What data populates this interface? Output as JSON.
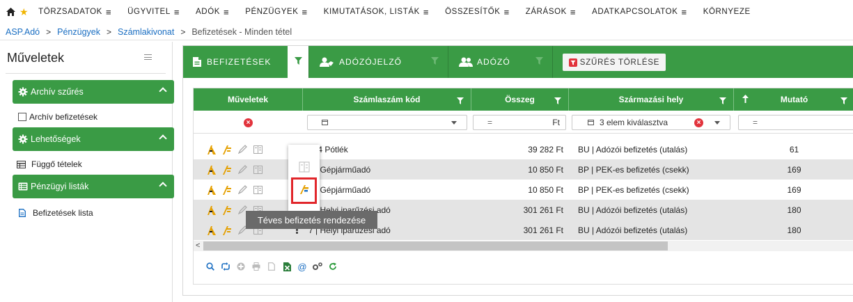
{
  "topmenu": {
    "items": [
      {
        "label": "TÖRZSADATOK"
      },
      {
        "label": "ÜGYVITEL"
      },
      {
        "label": "ADÓK"
      },
      {
        "label": "PÉNZÜGYEK"
      },
      {
        "label": "KIMUTATÁSOK, LISTÁK"
      },
      {
        "label": "ÖSSZESÍTŐK"
      },
      {
        "label": "ZÁRÁSOK"
      },
      {
        "label": "ADATKAPCSOLATOK"
      },
      {
        "label": "KÖRNYEZE"
      }
    ],
    "menu_glyph": "≡"
  },
  "breadcrumb": {
    "items": [
      "ASP.Adó",
      "Pénzügyek",
      "Számlakivonat"
    ],
    "current": "Befizetések - Minden tétel",
    "separator": ">"
  },
  "sidebar": {
    "title": "Műveletek",
    "groups": [
      {
        "label": "Archív szűrés",
        "icon": "gear-icon"
      },
      {
        "label": "Lehetőségek",
        "icon": "gear-icon"
      },
      {
        "label": "Pénzügyi listák",
        "icon": "list-icon"
      }
    ],
    "items": {
      "archiv": "Archív befizetések",
      "fuggo": "Függő tételek",
      "befizetesek_lista": "Befizetések lista"
    }
  },
  "toolbar": {
    "befizetesek": "BEFIZETÉSEK",
    "adozojelzo": "ADÓZÓJELZŐ",
    "adozo": "ADÓZÓ",
    "clear_filters": "SZŰRÉS TÖRLÉSE"
  },
  "grid": {
    "columns": {
      "muveletek": "Műveletek",
      "szamlaszam": "Számlaszám kód",
      "osszeg": "Összeg",
      "szarmazasi": "Származási hely",
      "mutato": "Mutató"
    },
    "filters": {
      "osszeg_op": "=",
      "osszeg_unit": "Ft",
      "szarmazasi_value": "3 elem kiválasztva",
      "mutato_op": "="
    },
    "rows": [
      {
        "kod": "404 Pótlék",
        "osszeg": "39 282 Ft",
        "szarmazasi": "BU | Adózói befizetés (utalás)",
        "mutato": "61"
      },
      {
        "kod": "4 | Gépjárműadó",
        "osszeg": "10 850 Ft",
        "szarmazasi": "BP | PEK-es befizetés (csekk)",
        "mutato": "169"
      },
      {
        "kod": "4 | Gépjárműadó",
        "osszeg": "10 850 Ft",
        "szarmazasi": "BP | PEK-es befizetés (csekk)",
        "mutato": "169"
      },
      {
        "kod": "7 | Helyi iparűzési adó",
        "osszeg": "301 261 Ft",
        "szarmazasi": "BU | Adózói befizetés (utalás)",
        "mutato": "180"
      },
      {
        "kod": "7 | Helyi iparűzési adó",
        "osszeg": "301 261 Ft",
        "szarmazasi": "BU | Adózói befizetés (utalás)",
        "mutato": "180"
      }
    ]
  },
  "tooltip": "Téves befizetés rendezése",
  "colors": {
    "green": "#3a9b45",
    "link": "#1a6ec2",
    "danger": "#e2333c",
    "highlight": "#e1262b"
  }
}
